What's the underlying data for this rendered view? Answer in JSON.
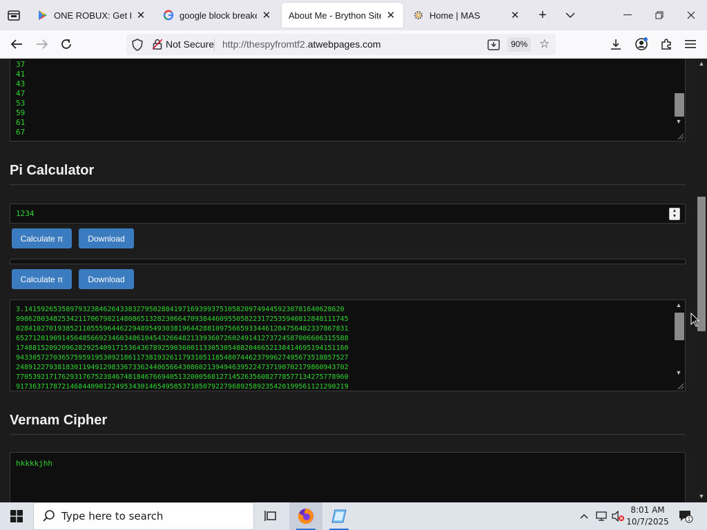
{
  "tabs": [
    {
      "title": "ONE ROBUX: Get Real R",
      "active": false
    },
    {
      "title": "google block breaker -",
      "active": false
    },
    {
      "title": "About Me - Brython Site",
      "active": true
    },
    {
      "title": "Home | MAS",
      "active": false
    }
  ],
  "navbar": {
    "security_label": "Not Secure",
    "url_prefix": "http://thespyfromtf2.",
    "url_domain": "atwebpages.com",
    "zoom": "90%"
  },
  "page": {
    "primes": [
      "37",
      "41",
      "43",
      "47",
      "53",
      "59",
      "61",
      "67"
    ],
    "pi_heading": "Pi Calculator",
    "pi_input_value": "1234",
    "calculate_label": "Calculate π",
    "download_label": "Download",
    "pi_digits": [
      "3.14159265358979323846264338327950288419716939937510582097494459230781640628620",
      "99862803482534211706798214808651328230664709384460955058223172535940812848111745",
      "02841027019385211055596446229489549303819644288109756659334461284756482337867831",
      "65271201909145648566923460348610454326648213393607260249141273724587006606315588",
      "17488152092096282925409171536436789259036001133053054882046652138414695194151160",
      "94330572703657595919530921861173819326117931051185480744623799627495673518857527",
      "24891227938183011949129833673362440656643086021394946395224737190702179860943702",
      "77053921717629317675238467481846766940513200056812714526356082778577134275778960",
      "91736371787214684409012249534301465495853710507922796892589235420199561121290219"
    ],
    "cipher_heading": "Vernam Cipher",
    "cipher_input_value": "hkkkkjhh"
  },
  "taskbar": {
    "search_placeholder": "Type here to search",
    "time": "8:01 AM",
    "date": "10/7/2025",
    "notification_count": "1"
  }
}
